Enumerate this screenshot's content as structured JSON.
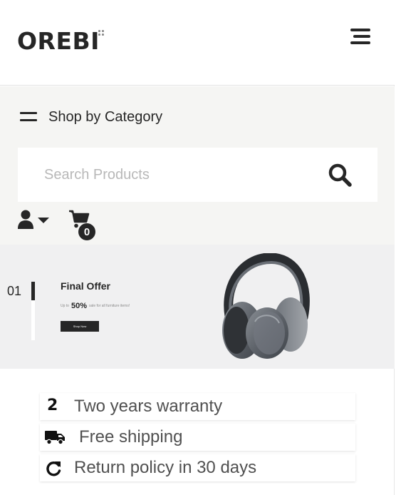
{
  "header": {
    "logo": "OREBI",
    "menu_icon": "menu-icon"
  },
  "category": {
    "label": "Shop by Category",
    "icon": "category-menu-icon"
  },
  "search": {
    "placeholder": "Search Products",
    "value": "",
    "icon": "search-icon"
  },
  "account": {
    "icon": "user-icon",
    "caret_icon": "caret-down-icon"
  },
  "cart": {
    "icon": "cart-icon",
    "count": "0"
  },
  "banner": {
    "slide_number": "01",
    "active_slide_fraction": 0.32,
    "title": "Final Offer",
    "prefix": "Up to",
    "discount": "50%",
    "suffix": "sale for all furniture items!",
    "button_label": "Shop Now",
    "image": "headphones"
  },
  "features": [
    {
      "icon": "2",
      "icon_name": "two-years-icon",
      "label": "Two years warranty"
    },
    {
      "icon": "truck-icon",
      "label": "Free shipping"
    },
    {
      "icon": "refresh-icon",
      "label": "Return policy in 30 days"
    }
  ],
  "colors": {
    "primary": "#262626",
    "background_band": "#f5f5f3",
    "banner_bg": "#f0f0f1",
    "placeholder": "#b8b8b8",
    "feature_text": "#505050"
  }
}
